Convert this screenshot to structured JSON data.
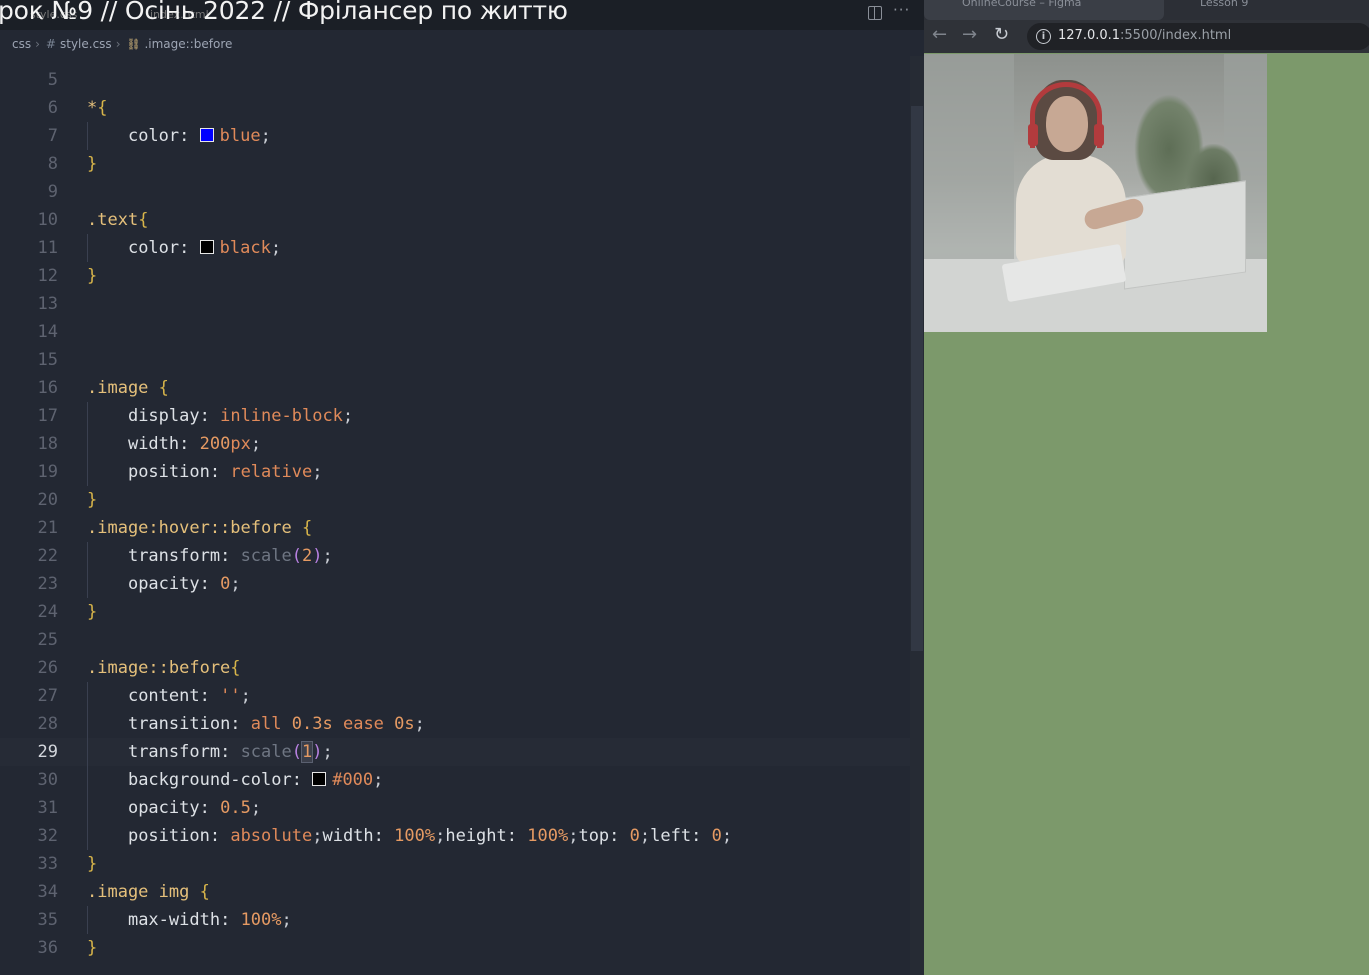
{
  "video_title": "рок №9 // Осінь 2022 // Фрілансер по життю",
  "editor": {
    "ghost_tab_1": "style.css",
    "ghost_tab_2": "index.html",
    "breadcrumb": {
      "folder": "css",
      "file": "style.css",
      "symbol": ".image::before"
    },
    "lines": [
      {
        "n": "5",
        "kind": "blank"
      },
      {
        "n": "6",
        "kind": "open",
        "selector": "*",
        "brace": "{"
      },
      {
        "n": "7",
        "kind": "decl-color",
        "prop": "color:",
        "swatch": "#0000ff",
        "value": "blue"
      },
      {
        "n": "8",
        "kind": "close",
        "brace": "}"
      },
      {
        "n": "9",
        "kind": "blank"
      },
      {
        "n": "10",
        "kind": "open",
        "selector": ".text",
        "brace": "{"
      },
      {
        "n": "11",
        "kind": "decl-color",
        "prop": "color:",
        "swatch": "#000000",
        "value": "black"
      },
      {
        "n": "12",
        "kind": "close",
        "brace": "}"
      },
      {
        "n": "13",
        "kind": "blank"
      },
      {
        "n": "14",
        "kind": "blank"
      },
      {
        "n": "15",
        "kind": "blank"
      },
      {
        "n": "16",
        "kind": "open",
        "selector": ".image ",
        "brace": "{"
      },
      {
        "n": "17",
        "kind": "decl",
        "prop": "display:",
        "value": "inline-block"
      },
      {
        "n": "18",
        "kind": "decl-num",
        "prop": "width:",
        "num": "200",
        "unit": "px"
      },
      {
        "n": "19",
        "kind": "decl",
        "prop": "position:",
        "value": "relative"
      },
      {
        "n": "20",
        "kind": "close",
        "brace": "}"
      },
      {
        "n": "21",
        "kind": "open",
        "selector": ".image:hover::before ",
        "brace": "{"
      },
      {
        "n": "22",
        "kind": "decl-fn",
        "prop": "transform:",
        "fn": "scale",
        "arg": "2"
      },
      {
        "n": "23",
        "kind": "decl-num",
        "prop": "opacity:",
        "num": "0",
        "unit": ""
      },
      {
        "n": "24",
        "kind": "close",
        "brace": "}"
      },
      {
        "n": "25",
        "kind": "blank"
      },
      {
        "n": "26",
        "kind": "open",
        "selector": ".image::before",
        "brace": "{"
      },
      {
        "n": "27",
        "kind": "decl",
        "prop": "content:",
        "value": "''"
      },
      {
        "n": "28",
        "kind": "decl-transition",
        "prop": "transition:",
        "v1": "all",
        "v2": "0.3s",
        "v3": "ease",
        "v4": "0s"
      },
      {
        "n": "29",
        "kind": "decl-fn-cursor",
        "prop": "transform:",
        "fn": "scale",
        "arg": "1",
        "current": true
      },
      {
        "n": "30",
        "kind": "decl-color",
        "prop": "background-color:",
        "swatch": "#000000",
        "value": "#000"
      },
      {
        "n": "31",
        "kind": "decl-num",
        "prop": "opacity:",
        "num": "0.5",
        "unit": ""
      },
      {
        "n": "32",
        "kind": "decl-multi",
        "p1": "position:",
        "v1": "absolute",
        "p2": "width:",
        "v2": "100%",
        "p3": "height:",
        "v3": "100%",
        "p4": "top:",
        "v4": "0",
        "p5": "left:",
        "v5": "0"
      },
      {
        "n": "33",
        "kind": "close",
        "brace": "}"
      },
      {
        "n": "34",
        "kind": "open",
        "selector": ".image img ",
        "brace": "{"
      },
      {
        "n": "35",
        "kind": "decl-num",
        "prop": "max-width:",
        "num": "100%",
        "unit": ""
      },
      {
        "n": "36",
        "kind": "close",
        "brace": "}"
      }
    ]
  },
  "browser": {
    "tab_1": "OnlineCourse – Figma",
    "tab_2": "Lesson 9",
    "url_host": "127.0.0.1",
    "url_rest": ":5500/index.html",
    "nav_back": "←",
    "nav_forward": "→",
    "nav_reload": "↻",
    "info_glyph": "i",
    "page_background": "#7c996b"
  }
}
